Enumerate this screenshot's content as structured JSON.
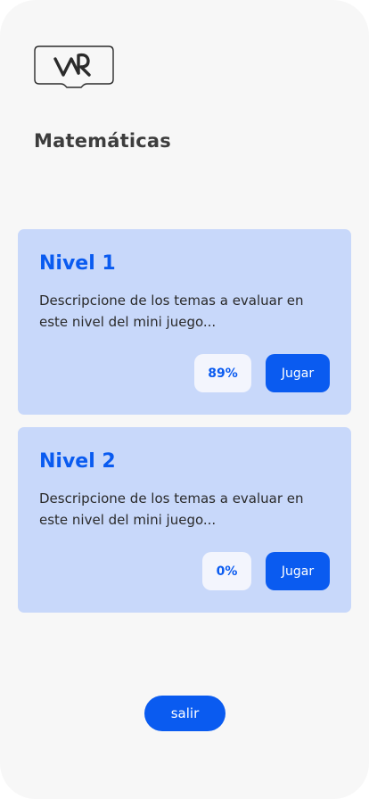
{
  "header": {
    "logo_icon": "vr-headset-logo-icon",
    "title": "Matemáticas"
  },
  "levels": [
    {
      "title": "Nivel 1",
      "description": "Descripcione de los temas a evaluar en este nivel del mini juego...",
      "progress": "89%",
      "play_label": "Jugar"
    },
    {
      "title": "Nivel 2",
      "description": "Descripcione de los temas a evaluar en este nivel del mini juego...",
      "progress": "0%",
      "play_label": "Jugar"
    }
  ],
  "footer": {
    "exit_label": "salir"
  },
  "colors": {
    "accent": "#0a5bf0",
    "card_background": "#c8d8fa",
    "progress_pill_background": "#f3f5fd",
    "screen_background": "#f7f7f7",
    "title_text": "#3d3d3d"
  }
}
